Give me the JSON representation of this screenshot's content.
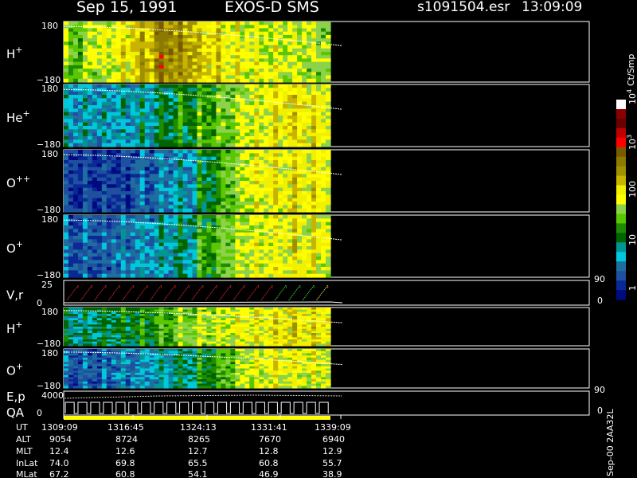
{
  "header": {
    "date": "Sep 15, 1991",
    "mission": "EXOS-D SMS",
    "file": "s1091504.esr",
    "time": "13:09:09"
  },
  "panels": [
    {
      "label": "H",
      "sup": "+",
      "top_tick": "180",
      "bottom_tick": "−180"
    },
    {
      "label": "He",
      "sup": "+",
      "top_tick": "180",
      "bottom_tick": "−180"
    },
    {
      "label": "O",
      "sup": "++",
      "top_tick": "180",
      "bottom_tick": "−180"
    },
    {
      "label": "O",
      "sup": "+",
      "top_tick": "180",
      "bottom_tick": "−180"
    },
    {
      "label": "V,r",
      "sup": "",
      "top_tick": "25",
      "bottom_tick": "0",
      "right_top": "90",
      "right_bottom": "0"
    },
    {
      "label": "H",
      "sup": "+",
      "top_tick": "180",
      "bottom_tick": "−180"
    },
    {
      "label": "O",
      "sup": "+",
      "top_tick": "180",
      "bottom_tick": "−180"
    },
    {
      "label": "E,p",
      "sup": "",
      "label2": "QA",
      "top_tick": "4000",
      "bottom_tick": "0",
      "right_top": "90",
      "right_bottom": "0"
    }
  ],
  "colorbar": {
    "unit_label": "Ct/Smp",
    "tick_labels": [
      "10",
      "10",
      "100",
      "10",
      "1"
    ],
    "tick_exponents": [
      "4",
      "3",
      "",
      "",
      ""
    ],
    "colors": [
      "#ffffff",
      "#8b0000",
      "#6b0000",
      "#c00000",
      "#ff0000",
      "#7a5a00",
      "#8c7a00",
      "#a09000",
      "#c8b400",
      "#f0f000",
      "#ffff00",
      "#8cd24b",
      "#5ac800",
      "#1e8c00",
      "#006400",
      "#009696",
      "#00c8dc",
      "#1e6ea0",
      "#1e50a0",
      "#0a2896",
      "#000a80"
    ]
  },
  "footer": {
    "row_labels": [
      "UT",
      "ALT",
      "MLT",
      "InLat",
      "MLat"
    ],
    "columns": [
      [
        "1309:09",
        "9054",
        "12.4",
        "74.0",
        "67.2"
      ],
      [
        "1316:45",
        "8724",
        "12.6",
        "69.8",
        "60.8"
      ],
      [
        "1324:13",
        "8265",
        "12.7",
        "65.5",
        "54.1"
      ],
      [
        "1331:41",
        "7670",
        "12.8",
        "60.8",
        "46.9"
      ],
      [
        "1339:09",
        "6940",
        "12.9",
        "55.7",
        "38.9"
      ]
    ],
    "version": "Sep-00 2AA32L"
  },
  "chart_data": {
    "type": "heatmap",
    "title": "Sep 15, 1991 EXOS-D SMS",
    "xlabel": "UT",
    "x_tick_labels": [
      "1309:09",
      "1316:45",
      "1324:13",
      "1331:41",
      "1339:09"
    ],
    "time_range": [
      "1309:09",
      "1339:09"
    ],
    "data_ends_at": "1339:09",
    "color_scale": "log",
    "color_range": [
      1,
      10000
    ],
    "color_unit": "Ct/Smp",
    "series": [
      {
        "name": "H+",
        "ylim": [
          -180,
          180
        ],
        "count_levels": [
          40,
          70,
          100,
          200,
          500,
          300,
          150,
          100,
          90,
          80,
          70,
          60
        ]
      },
      {
        "name": "He+",
        "ylim": [
          -180,
          180
        ],
        "count_levels": [
          6,
          6,
          7,
          8,
          12,
          18,
          30,
          50,
          80,
          110,
          140,
          120
        ]
      },
      {
        "name": "O++",
        "ylim": [
          -180,
          180
        ],
        "count_levels": [
          2,
          2,
          2,
          3,
          4,
          6,
          15,
          40,
          80,
          110,
          130,
          110
        ]
      },
      {
        "name": "O+",
        "ylim": [
          -180,
          180
        ],
        "count_levels": [
          3,
          3,
          4,
          5,
          7,
          10,
          25,
          50,
          80,
          100,
          120,
          100
        ]
      },
      {
        "name": "V,r",
        "ylim": [
          0,
          25
        ],
        "right_ylim": [
          0,
          90
        ]
      },
      {
        "name": "H+",
        "ylim": [
          -180,
          180
        ],
        "count_levels": [
          10,
          12,
          15,
          20,
          30,
          50,
          60,
          80,
          100,
          120,
          140,
          130
        ]
      },
      {
        "name": "O+",
        "ylim": [
          -180,
          180
        ],
        "count_levels": [
          3,
          3,
          4,
          5,
          8,
          12,
          20,
          40,
          70,
          90,
          100,
          90
        ]
      },
      {
        "name": "E,p",
        "ylim": [
          0,
          4000
        ],
        "right_ylim": [
          0,
          90
        ]
      }
    ]
  }
}
